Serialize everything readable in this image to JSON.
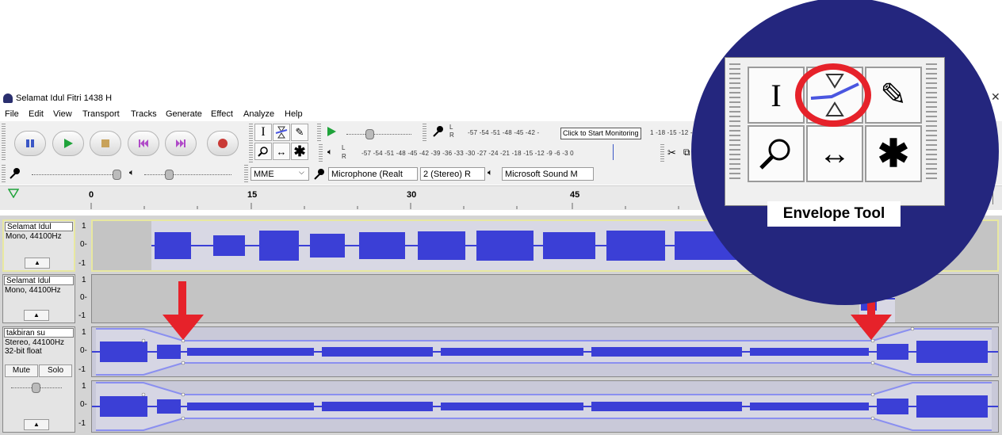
{
  "window": {
    "title": "Selamat Idul Fitri 1438 H",
    "close_glyph": "✕",
    "restore_glyph": "☐"
  },
  "menu": [
    "File",
    "Edit",
    "View",
    "Transport",
    "Tracks",
    "Generate",
    "Effect",
    "Analyze",
    "Help"
  ],
  "meters": {
    "record_scale": "-57 -54 -51 -48 -45 -42 -",
    "record_hint": "Click to Start Monitoring",
    "record_scale_tail": "1 -18 -15 -12 -9",
    "play_scale": "-57 -54 -51 -48 -45 -42 -39 -36 -33 -30 -27 -24 -21 -18 -15 -12 -9 -6 -3 0",
    "L": "L",
    "R": "R"
  },
  "device_bar": {
    "host": "MME",
    "recording_device": "Microphone (Realt",
    "channels": "2 (Stereo) R",
    "playback_device": "Microsoft Sound M"
  },
  "ruler": {
    "labels": [
      "0",
      "15",
      "30",
      "45"
    ]
  },
  "tracks": [
    {
      "name": "Selamat Idul",
      "info1": "Mono, 44100Hz",
      "info2": "",
      "scale": [
        "1",
        "0-",
        "-1"
      ]
    },
    {
      "name": "Selamat Idul",
      "info1": "Mono, 44100Hz",
      "info2": "",
      "scale": [
        "1",
        "0-",
        "-1"
      ]
    },
    {
      "name": "takbiran su",
      "info1": "Stereo, 44100Hz",
      "info2": "32-bit float",
      "scale": [
        "1",
        "0-",
        "-1",
        "1",
        "0-",
        "-1"
      ],
      "mute_label": "Mute",
      "solo_label": "Solo"
    }
  ],
  "callout": {
    "label": "Envelope Tool"
  },
  "colors": {
    "accent": "#e6222a",
    "overlay": "#24267e",
    "waveform": "#3b3fd6",
    "envelope": "#8a8ff0"
  },
  "icons": [
    "audacity-icon",
    "pause-icon",
    "play-icon",
    "stop-icon",
    "skip-start-icon",
    "skip-end-icon",
    "record-icon",
    "selection-tool-icon",
    "envelope-tool-icon",
    "draw-tool-icon",
    "zoom-tool-icon",
    "timeshift-tool-icon",
    "multi-tool-icon",
    "microphone-icon",
    "speaker-icon",
    "down-arrow-icon"
  ]
}
